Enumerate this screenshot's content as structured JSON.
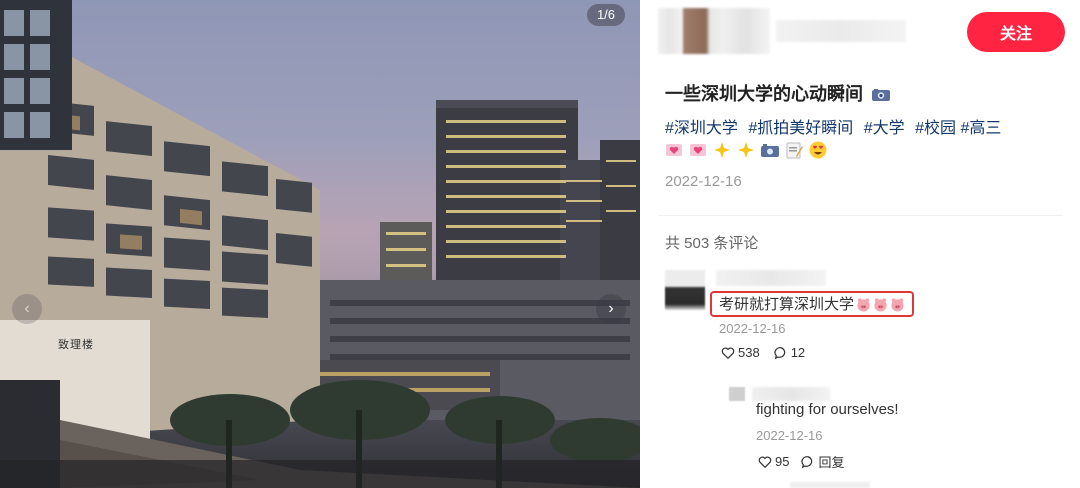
{
  "photo": {
    "counter": "1/6",
    "building_sign": "致理楼",
    "prev_icon": "chevron-left-icon",
    "next_icon": "chevron-right-icon"
  },
  "author": {
    "follow_label": "关注"
  },
  "note": {
    "title": "一些深圳大学的心动瞬间",
    "title_emoji": "camera-icon",
    "tags": [
      "#深圳大学",
      "#抓拍美好瞬间",
      "#大学",
      "#校园",
      "#高三"
    ],
    "emojis": [
      "heart-letter-icon",
      "heart-letter-icon",
      "sparkles-icon",
      "sparkles-icon",
      "camera-icon",
      "memo-icon",
      "heart-eyes-icon"
    ],
    "date": "2022-12-16"
  },
  "comments": {
    "count_label": "共 503 条评论",
    "items": [
      {
        "text": "考研就打算深圳大学",
        "emojis": [
          "pig-icon",
          "pig-icon",
          "pig-icon"
        ],
        "date": "2022-12-16",
        "likes": "538",
        "replies": "12",
        "highlight_color": "#e0353b",
        "reply": {
          "text": "fighting for ourselves!",
          "date": "2022-12-16",
          "likes": "95",
          "reply_label": "回复"
        }
      }
    ]
  },
  "colors": {
    "accent": "#ff2442",
    "tag": "#13386c",
    "muted": "#999999"
  }
}
